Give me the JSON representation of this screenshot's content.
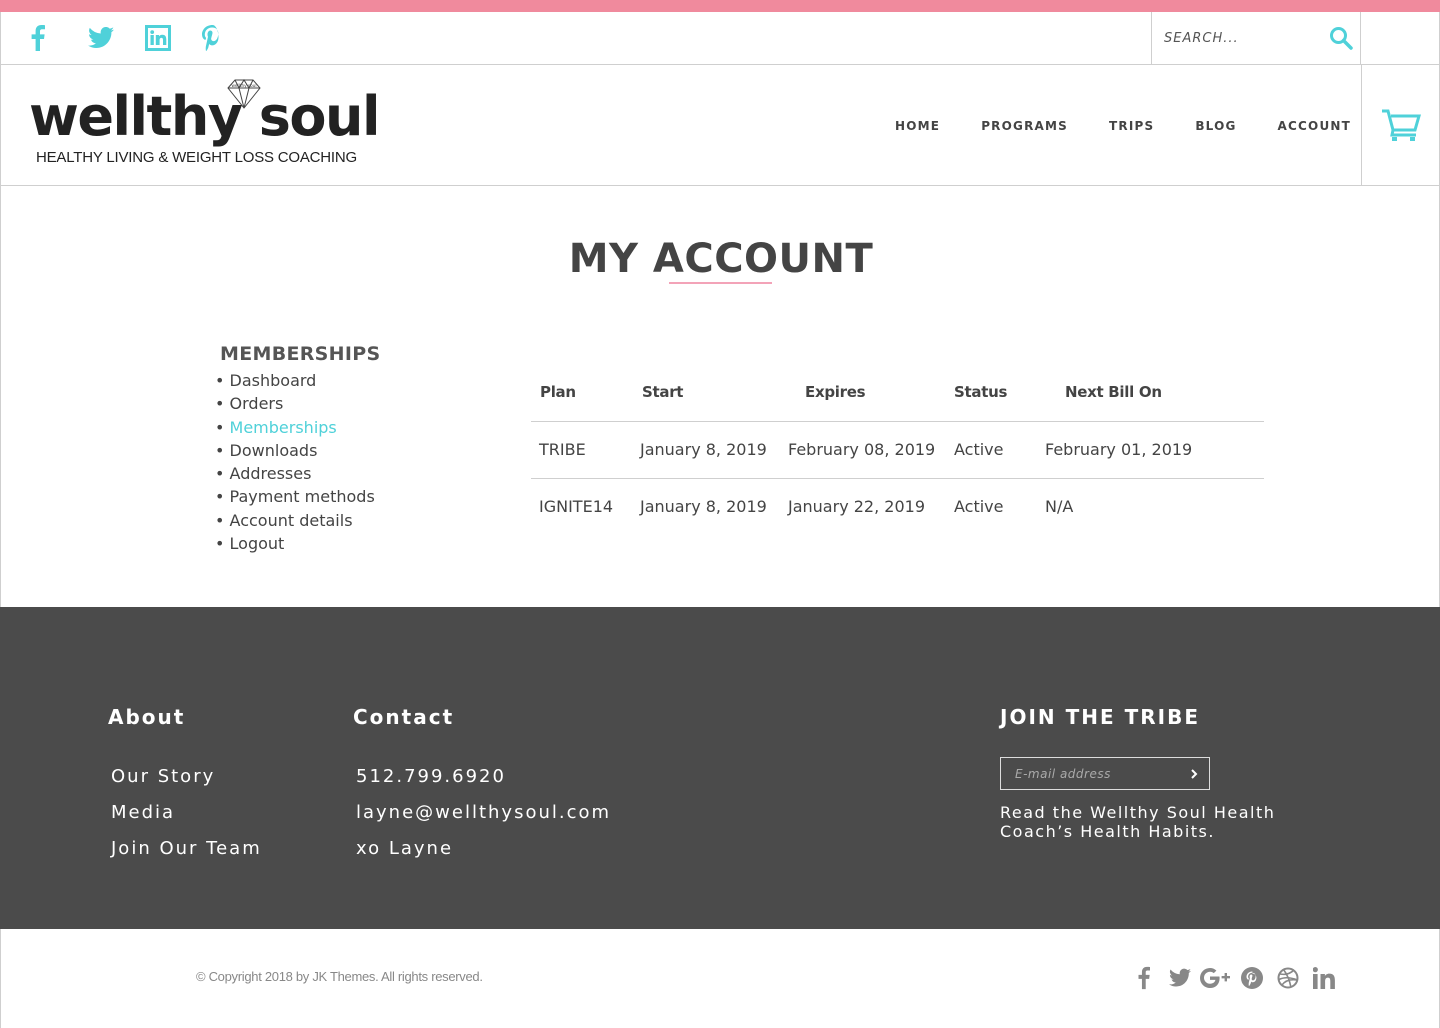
{
  "colors": {
    "accent": "#4fd1d9",
    "topbar": "#f08a9d",
    "footer_bg": "#4b4b4b",
    "underline": "#f3a3b8"
  },
  "topbar_social": [
    "facebook-icon",
    "twitter-icon",
    "linkedin-icon",
    "pinterest-icon"
  ],
  "search": {
    "placeholder": "SEARCH..."
  },
  "logo": {
    "word": "wellthy soul",
    "badge_text": "wellthy soul",
    "tagline": "HEALTHY LIVING & WEIGHT LOSS COACHING"
  },
  "nav": {
    "home": "HOME",
    "programs": "PROGRAMS",
    "trips": "TRIPS",
    "blog": "BLOG",
    "account": "ACCOUNT"
  },
  "page": {
    "title": "MY ACCOUNT"
  },
  "account_nav": {
    "heading": "MEMBERSHIPS",
    "items": [
      {
        "label": "Dashboard"
      },
      {
        "label": "Orders"
      },
      {
        "label": "Memberships"
      },
      {
        "label": "Downloads"
      },
      {
        "label": "Addresses"
      },
      {
        "label": "Payment methods"
      },
      {
        "label": "Account details"
      },
      {
        "label": "Logout"
      }
    ],
    "active": "Memberships"
  },
  "memberships": {
    "columns": [
      "Plan",
      "Start",
      "Expires",
      "Status",
      "Next Bill On"
    ],
    "rows": [
      [
        "TRIBE",
        "January 8, 2019",
        "February 08, 2019",
        "Active",
        "February 01, 2019"
      ],
      [
        "IGNITE14",
        "January 8, 2019",
        "January 22, 2019",
        "Active",
        "N/A"
      ]
    ]
  },
  "footer": {
    "about": {
      "heading": "About",
      "links": [
        "Our Story",
        "Media",
        "Join Our Team"
      ]
    },
    "contact": {
      "heading": "Contact",
      "lines": [
        "512.799.6920",
        "layne@wellthysoul.com",
        "xo Layne"
      ]
    },
    "tribe": {
      "heading": "JOIN THE TRIBE",
      "email_placeholder": "E-mail address",
      "note": "Read the Wellthy Soul Health Coach’s Health Habits."
    }
  },
  "bottom": {
    "copyright": "© Copyright 2018 by JK Themes. All rights reserved.",
    "social": [
      "facebook-icon",
      "twitter-icon",
      "google-plus-icon",
      "pinterest-icon",
      "dribbble-icon",
      "linkedin-icon"
    ]
  }
}
